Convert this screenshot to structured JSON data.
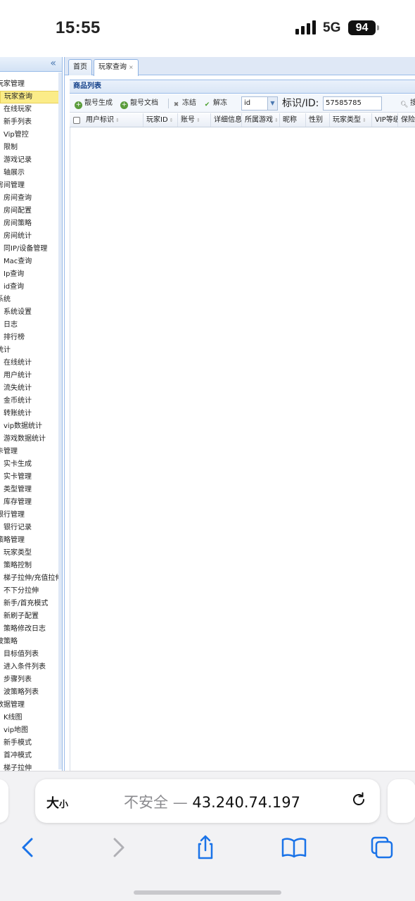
{
  "status": {
    "time": "15:55",
    "network": "5G",
    "battery": "94"
  },
  "sidebar": {
    "collapse": "«",
    "rows": [
      {
        "label": "玩家管理",
        "kind": "group"
      },
      {
        "label": "玩家查询",
        "kind": "item",
        "selected": true
      },
      {
        "label": "在线玩家",
        "kind": "item"
      },
      {
        "label": "新手列表",
        "kind": "item"
      },
      {
        "label": "Vip管控",
        "kind": "item"
      },
      {
        "label": "限制",
        "kind": "item"
      },
      {
        "label": "游戏记录",
        "kind": "item"
      },
      {
        "label": "轴展示",
        "kind": "item"
      },
      {
        "label": "房间管理",
        "kind": "group"
      },
      {
        "label": "房间查询",
        "kind": "item"
      },
      {
        "label": "房间配置",
        "kind": "item"
      },
      {
        "label": "房间策略",
        "kind": "item"
      },
      {
        "label": "房间统计",
        "kind": "item"
      },
      {
        "label": "同IP/设备管理",
        "kind": "item"
      },
      {
        "label": "Mac查询",
        "kind": "item"
      },
      {
        "label": "Ip查询",
        "kind": "item"
      },
      {
        "label": "id查询",
        "kind": "item"
      },
      {
        "label": "系统",
        "kind": "group"
      },
      {
        "label": "系统设置",
        "kind": "item"
      },
      {
        "label": "日志",
        "kind": "item"
      },
      {
        "label": "排行榜",
        "kind": "item"
      },
      {
        "label": "统计",
        "kind": "group"
      },
      {
        "label": "在线统计",
        "kind": "item"
      },
      {
        "label": "用户统计",
        "kind": "item"
      },
      {
        "label": "流失统计",
        "kind": "item"
      },
      {
        "label": "金币统计",
        "kind": "item"
      },
      {
        "label": "转账统计",
        "kind": "item"
      },
      {
        "label": "vip数据统计",
        "kind": "item"
      },
      {
        "label": "游戏数据统计",
        "kind": "item"
      },
      {
        "label": "卡管理",
        "kind": "group"
      },
      {
        "label": "实卡生成",
        "kind": "item"
      },
      {
        "label": "实卡管理",
        "kind": "item"
      },
      {
        "label": "类型管理",
        "kind": "item"
      },
      {
        "label": "库存管理",
        "kind": "item"
      },
      {
        "label": "银行管理",
        "kind": "group"
      },
      {
        "label": "银行记录",
        "kind": "item"
      },
      {
        "label": "策略管理",
        "kind": "group"
      },
      {
        "label": "玩家类型",
        "kind": "item"
      },
      {
        "label": "策略控制",
        "kind": "item"
      },
      {
        "label": "梯子拉伸/充值拉伸",
        "kind": "item"
      },
      {
        "label": "不下分拉伸",
        "kind": "item"
      },
      {
        "label": "新手/首充模式",
        "kind": "item"
      },
      {
        "label": "新刷子配置",
        "kind": "item"
      },
      {
        "label": "策略修改日志",
        "kind": "item"
      },
      {
        "label": "波策略",
        "kind": "group"
      },
      {
        "label": "目标值列表",
        "kind": "item"
      },
      {
        "label": "进入条件列表",
        "kind": "item"
      },
      {
        "label": "步骤列表",
        "kind": "item"
      },
      {
        "label": "波策略列表",
        "kind": "item"
      },
      {
        "label": "数据管理",
        "kind": "group"
      },
      {
        "label": "K线图",
        "kind": "item"
      },
      {
        "label": "vip地图",
        "kind": "item"
      },
      {
        "label": "新手模式",
        "kind": "item"
      },
      {
        "label": "首冲模式",
        "kind": "item"
      },
      {
        "label": "梯子拉伸",
        "kind": "item"
      }
    ]
  },
  "tabs": {
    "home": "首页",
    "active": "玩家查询",
    "close": "×"
  },
  "panel": {
    "title": "商品列表"
  },
  "toolbar": {
    "gen": "靓号生成",
    "doc": "靓号文档",
    "freeze": "冻结",
    "unfreeze": "解冻",
    "select_value": "id",
    "id_label": "标识/ID:",
    "id_value": "57585785",
    "search": "搜索"
  },
  "grid": {
    "columns": [
      "用户标识",
      "玩家ID",
      "账号",
      "详细信息",
      "所属游戏",
      "昵称",
      "性别",
      "玩家类型",
      "VIP等级",
      "保险箱金"
    ]
  },
  "safari": {
    "text_size": "大",
    "text_size_small": "小",
    "insecure": "不安全",
    "dash": "—",
    "host": "43.240.74.197"
  }
}
